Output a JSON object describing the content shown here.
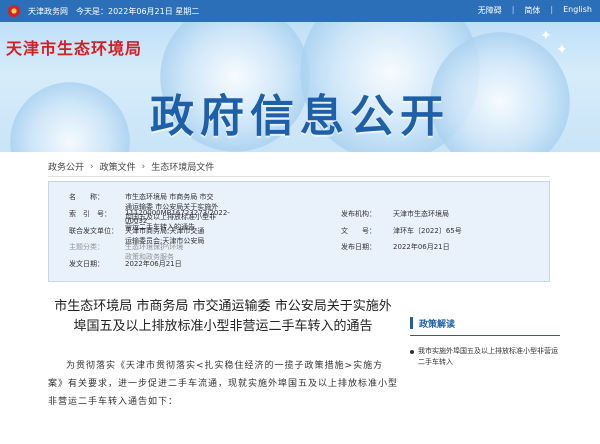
{
  "topbar": {
    "site_name": "天津政务网",
    "date_text": "今天是：2022年06月21日 星期二",
    "links": [
      "无障碍",
      "简体",
      "English"
    ]
  },
  "banner": {
    "city_title": "天津市生态环境局",
    "main_title": "政府信息公开"
  },
  "breadcrumb": [
    "政务公开",
    "政策文件",
    "生态环境局文件"
  ],
  "meta": {
    "labels": {
      "name": "名　　称：",
      "index": "索　引　号：",
      "joint_units": "联合发文单位：",
      "topic": "主题分类：",
      "issue_date": "发文日期：",
      "issuer": "发布机构：",
      "doc_no": "文　　号：",
      "publish_date": "发布日期："
    },
    "values": {
      "name": "市生态环境局 市商务局 市交通运输委 市公安局关于实施外埠国五及以上排放标准小型非营运二手车转入的通告",
      "index": "11120000MB16723273/2022-00032",
      "joint_units": "天津市商务局;天津市交通运输委员会;天津市公安局",
      "topic": "生态环境保护\\环境政策和政务服务",
      "issue_date": "2022年06月21日",
      "issuer": "天津市生态环境局",
      "doc_no": "津环车〔2022〕65号",
      "publish_date": "2022年06月21日"
    }
  },
  "article": {
    "title": "市生态环境局 市商务局 市交通运输委 市公安局关于实施外埠国五及以上排放标准小型非营运二手车转入的通告",
    "paragraph": "为贯彻落实《天津市贯彻落实<扎实稳住经济的一揽子政策措施>实施方案》有关要求，进一步促进二手车流通，现就实施外埠国五及以上排放标准小型非营运二手车转入通告如下："
  },
  "sidebar": {
    "title": "政策解读",
    "item": "我市实施外埠国五及以上排放标准小型非营运二手车转入"
  },
  "colors": {
    "topbar": "#2a6fb8",
    "accent": "#1f5fa8",
    "city_title": "#d21f24",
    "meta_bg": "#e9f1fb"
  }
}
